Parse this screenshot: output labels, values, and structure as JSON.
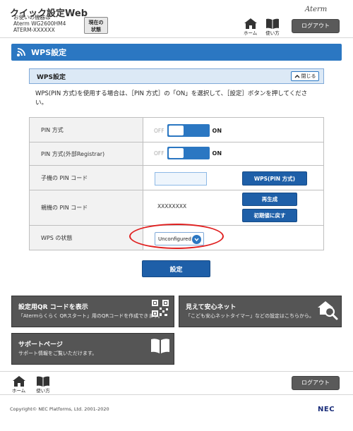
{
  "header": {
    "title": "クイック設定Web",
    "device_lines": [
      "お使いの機器は",
      "Aterm WG2600HM4",
      "ATERM-XXXXXX"
    ],
    "status_button": [
      "現在の",
      "状態"
    ],
    "brand": "Aterm",
    "home_label": "ホーム",
    "help_label": "使い方",
    "logout_label": "ログアウト"
  },
  "page": {
    "main_title": "WPS設定",
    "section_title": "WPS設定",
    "close_label": "閉じる",
    "description": "WPS(PIN 方式)を使用する場合は、［PIN 方式］の「ON」を選択して、［設定］ボタンを押してください。"
  },
  "form": {
    "pin_method": {
      "label": "PIN 方式",
      "off": "OFF",
      "on": "ON"
    },
    "pin_method_ext": {
      "label": "PIN 方式(外部Registrar)",
      "off": "OFF",
      "on": "ON"
    },
    "child_pin": {
      "label": "子機の PIN コード",
      "value": "",
      "button": "WPS(PIN 方式)"
    },
    "parent_pin": {
      "label": "親機の PIN コード",
      "value": "XXXXXXXX",
      "regen": "再生成",
      "reset": "初期値に戻す"
    },
    "wps_state": {
      "label": "WPS の状態",
      "selected": "Unconfigured"
    },
    "submit": "設定"
  },
  "tiles": {
    "qr": {
      "title": "設定用QR コードを表示",
      "desc": "「Atermらくらく QRスタート」用のQRコードを作成できます。"
    },
    "safety": {
      "title": "見えて安心ネット",
      "desc": "「こども安心ネットタイマー」などの設定はこちらから。"
    },
    "support": {
      "title": "サポートページ",
      "desc": "サポート情報をご覧いただけます。"
    }
  },
  "footer": {
    "home_label": "ホーム",
    "help_label": "使い方",
    "logout_label": "ログアウト",
    "copyright": "Copyright© NEC Platforms, Ltd. 2001-2020",
    "logo": "NEC"
  },
  "colors": {
    "accent": "#2b77c2",
    "button": "#1e5fa8",
    "tile": "#555555",
    "highlight": "#e02020"
  }
}
